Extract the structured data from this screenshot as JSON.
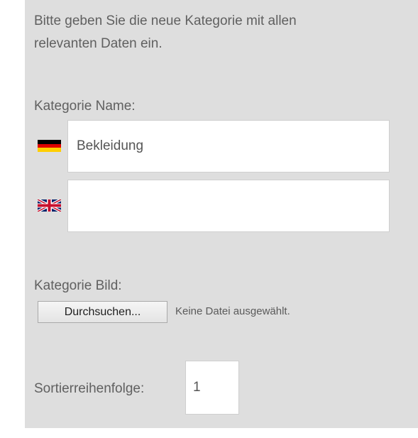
{
  "intro": {
    "line1": "Bitte geben Sie die neue Kategorie mit allen",
    "line2": "relevanten Daten ein."
  },
  "category_name": {
    "label": "Kategorie Name:",
    "fields": [
      {
        "language_icon": "german-flag-icon",
        "value": "Bekleidung"
      },
      {
        "language_icon": "uk-flag-icon",
        "value": ""
      }
    ]
  },
  "category_image": {
    "label": "Kategorie Bild:",
    "browse_label": "Durchsuchen...",
    "file_status": "Keine Datei ausgewählt."
  },
  "sort_order": {
    "label": "Sortierreihenfolge:",
    "value": "1"
  },
  "colors": {
    "panel_background": "#dedede",
    "field_background": "#ffffff",
    "text": "#606060"
  }
}
